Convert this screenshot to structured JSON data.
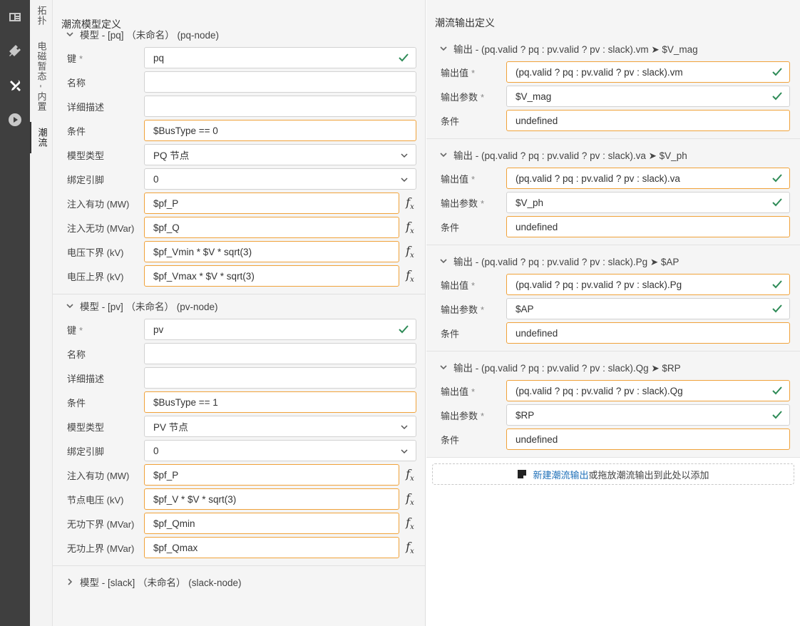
{
  "tabs": [
    "拓扑",
    "电磁暂态 - 内置",
    "潮流"
  ],
  "left": {
    "title": "潮流模型定义",
    "models": [
      {
        "header": "模型 - [pq] （未命名） (pq-node)",
        "fields": [
          {
            "label": "键",
            "required": true,
            "value": "pq",
            "kind": "check",
            "orange": false
          },
          {
            "label": "名称",
            "required": false,
            "value": "",
            "kind": "plain",
            "orange": false
          },
          {
            "label": "详细描述",
            "required": false,
            "value": "",
            "kind": "plain",
            "orange": false
          },
          {
            "label": "条件",
            "required": false,
            "value": "$BusType == 0",
            "kind": "plain",
            "orange": true
          },
          {
            "label": "模型类型",
            "required": false,
            "value": "PQ 节点",
            "kind": "select",
            "orange": false
          },
          {
            "label": "绑定引脚",
            "required": false,
            "value": "0",
            "kind": "select",
            "orange": false
          },
          {
            "label": "注入有功 (MW)",
            "required": false,
            "value": "$pf_P",
            "kind": "fx",
            "orange": true
          },
          {
            "label": "注入无功 (MVar)",
            "required": false,
            "value": "$pf_Q",
            "kind": "fx",
            "orange": true
          },
          {
            "label": "电压下界 (kV)",
            "required": false,
            "value": "$pf_Vmin * $V * sqrt(3)",
            "kind": "fx",
            "orange": true
          },
          {
            "label": "电压上界 (kV)",
            "required": false,
            "value": "$pf_Vmax * $V * sqrt(3)",
            "kind": "fx",
            "orange": true
          }
        ]
      },
      {
        "header": "模型 - [pv] （未命名） (pv-node)",
        "fields": [
          {
            "label": "键",
            "required": true,
            "value": "pv",
            "kind": "check",
            "orange": false
          },
          {
            "label": "名称",
            "required": false,
            "value": "",
            "kind": "plain",
            "orange": false
          },
          {
            "label": "详细描述",
            "required": false,
            "value": "",
            "kind": "plain",
            "orange": false
          },
          {
            "label": "条件",
            "required": false,
            "value": "$BusType == 1",
            "kind": "plain",
            "orange": true
          },
          {
            "label": "模型类型",
            "required": false,
            "value": "PV 节点",
            "kind": "select",
            "orange": false
          },
          {
            "label": "绑定引脚",
            "required": false,
            "value": "0",
            "kind": "select",
            "orange": false
          },
          {
            "label": "注入有功 (MW)",
            "required": false,
            "value": "$pf_P",
            "kind": "fx",
            "orange": true
          },
          {
            "label": "节点电压 (kV)",
            "required": false,
            "value": "$pf_V * $V * sqrt(3)",
            "kind": "fx",
            "orange": true
          },
          {
            "label": "无功下界 (MVar)",
            "required": false,
            "value": "$pf_Qmin",
            "kind": "fx",
            "orange": true
          },
          {
            "label": "无功上界 (MVar)",
            "required": false,
            "value": "$pf_Qmax",
            "kind": "fx",
            "orange": true
          }
        ]
      }
    ],
    "collapsed_model": "模型 - [slack] （未命名） (slack-node)"
  },
  "right": {
    "title": "潮流输出定义",
    "outputs": [
      {
        "header": "输出 - (pq.valid ? pq : pv.valid ? pv : slack).vm ➤ $V_mag",
        "value": "(pq.valid ? pq : pv.valid ? pv : slack).vm",
        "param": "$V_mag",
        "cond": "undefined"
      },
      {
        "header": "输出 - (pq.valid ? pq : pv.valid ? pv : slack).va ➤ $V_ph",
        "value": "(pq.valid ? pq : pv.valid ? pv : slack).va",
        "param": "$V_ph",
        "cond": "undefined"
      },
      {
        "header": "输出 - (pq.valid ? pq : pv.valid ? pv : slack).Pg ➤ $AP",
        "value": "(pq.valid ? pq : pv.valid ? pv : slack).Pg",
        "param": "$AP",
        "cond": "undefined"
      },
      {
        "header": "输出 - (pq.valid ? pq : pv.valid ? pv : slack).Qg ➤ $RP",
        "value": "(pq.valid ? pq : pv.valid ? pv : slack).Qg",
        "param": "$RP",
        "cond": "undefined"
      }
    ],
    "labels": {
      "value": "输出值",
      "param": "输出参数",
      "cond": "条件"
    },
    "add_link": "新建潮流输出",
    "add_text": "或拖放潮流输出到此处以添加"
  }
}
